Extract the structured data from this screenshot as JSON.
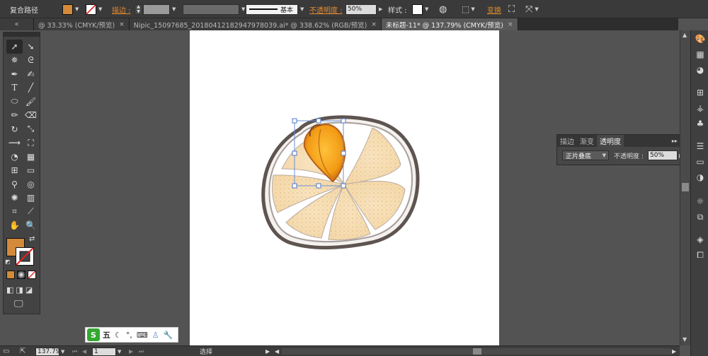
{
  "control_bar": {
    "object_type": "复合路径",
    "stroke_label": "描边 :",
    "stroke_style": "基本",
    "opacity_label": "不透明度 :",
    "opacity_value": "50%",
    "style_label": "样式 :",
    "transform_label": "变换",
    "fill_color": "#d38a3a",
    "accent_color": "#e38a2e"
  },
  "tabs": [
    {
      "label": "@ 33.33% (CMYK/预览)",
      "close": "×",
      "active": false
    },
    {
      "label": "Nipic_15097685_20180412182947978039.ai* @ 338.62% (RGB/预览)",
      "close": "×",
      "active": false
    },
    {
      "label": "未标题-11* @ 137.79% (CMYK/预览)",
      "close": "×",
      "active": true
    }
  ],
  "tabs_collapse": "«",
  "panel": {
    "tabs": [
      "描边",
      "渐变",
      "透明度"
    ],
    "blend_mode": "正片叠底",
    "opacity_label": "不透明度 :",
    "opacity_value": "50%"
  },
  "status": {
    "zoom": "137.79",
    "page": "1",
    "tool": "选择"
  },
  "ime": {
    "label": "五"
  }
}
